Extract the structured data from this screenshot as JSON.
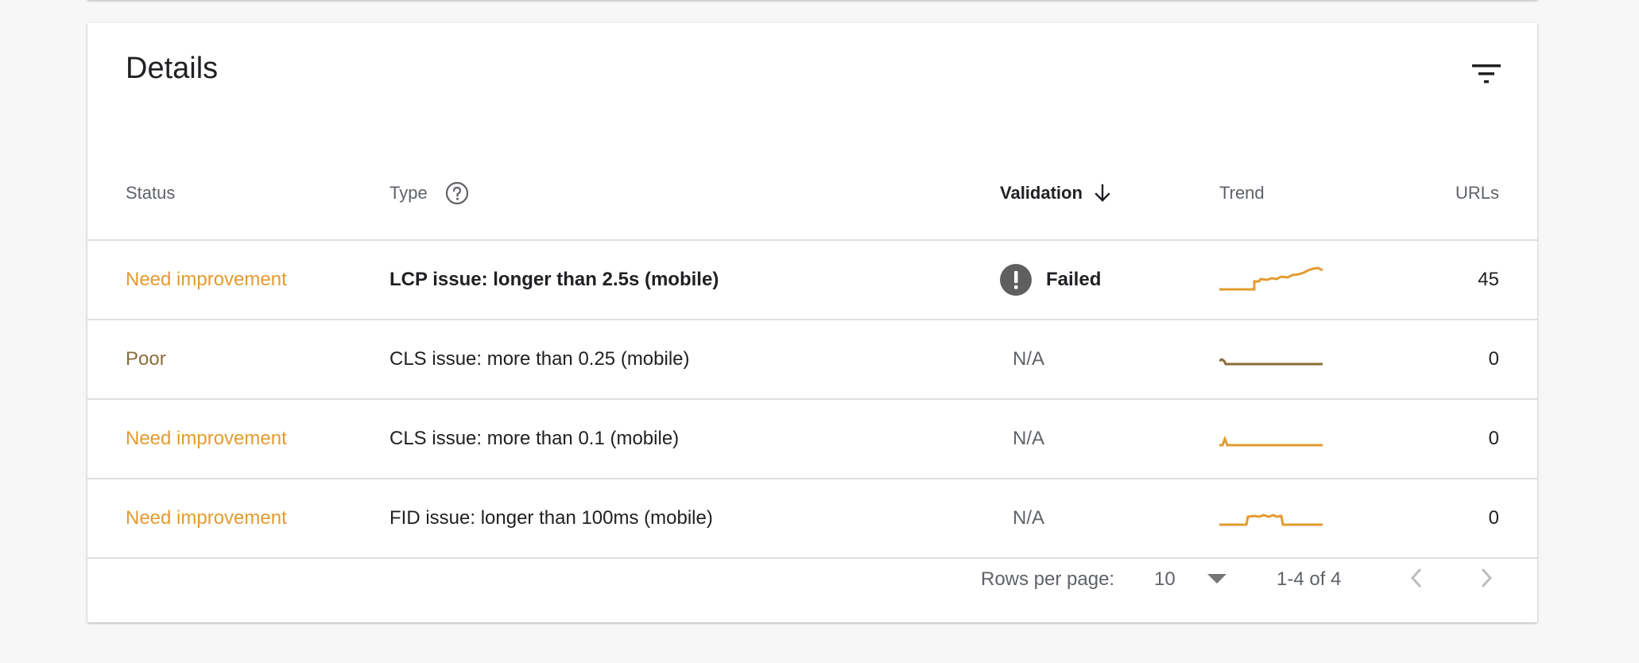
{
  "card": {
    "title": "Details"
  },
  "table": {
    "headers": {
      "status": "Status",
      "type": "Type",
      "validation": "Validation",
      "trend": "Trend",
      "urls": "URLs"
    },
    "rows": [
      {
        "status": "Need improvement",
        "type": "LCP issue: longer than 2.5s (mobile)",
        "validation": "Failed",
        "urls": "45"
      },
      {
        "status": "Poor",
        "type": "CLS issue: more than 0.25 (mobile)",
        "validation": "N/A",
        "urls": "0"
      },
      {
        "status": "Need improvement",
        "type": "CLS issue: more than 0.1 (mobile)",
        "validation": "N/A",
        "urls": "0"
      },
      {
        "status": "Need improvement",
        "type": "FID issue: longer than 100ms (mobile)",
        "validation": "N/A",
        "urls": "0"
      }
    ]
  },
  "pagination": {
    "rows_per_page_label": "Rows per page:",
    "rows_per_page_value": "10",
    "range": "1-4 of 4"
  },
  "colors": {
    "need_improvement": "#e39b2f",
    "poor": "#8a6d3b",
    "trend_line": "#e39b2f"
  },
  "icons": {
    "filter": "filter-icon",
    "help": "help-circle-icon",
    "sort": "arrow-down-icon",
    "failed": "error-icon",
    "dropdown": "caret-down-icon",
    "prev": "chevron-left-icon",
    "next": "chevron-right-icon"
  }
}
